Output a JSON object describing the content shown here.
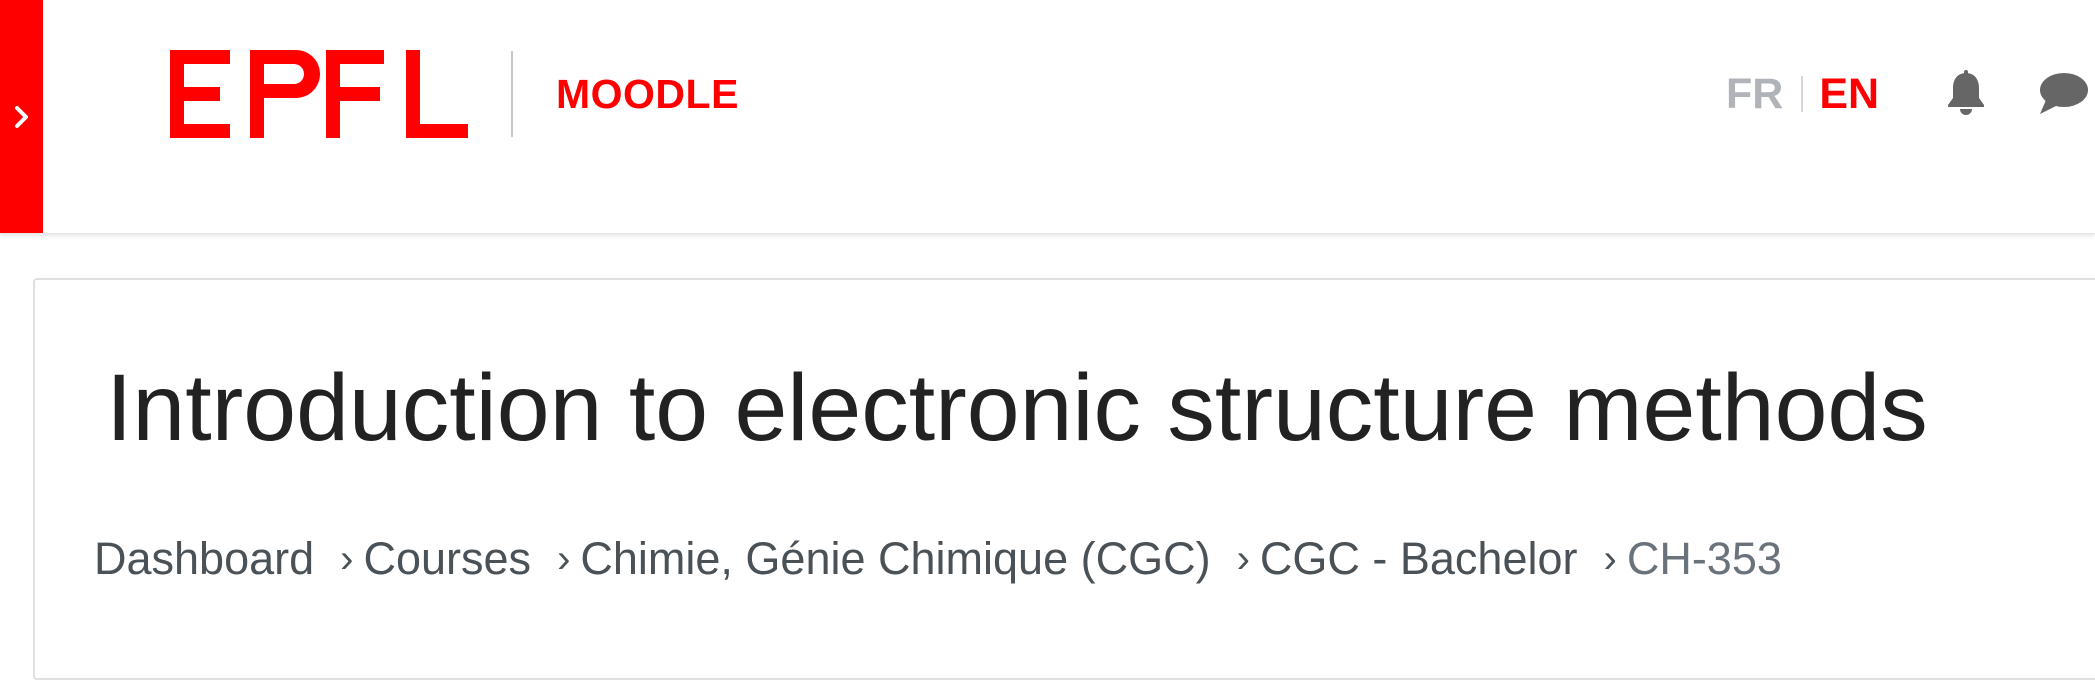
{
  "navbar": {
    "logo_text": "EPFL",
    "site_name": "MOODLE",
    "languages": {
      "fr": "FR",
      "en": "EN",
      "active": "EN"
    },
    "icons": [
      "chevron-right-icon",
      "bell-icon",
      "chat-icon"
    ],
    "accent_color": "#ff0000"
  },
  "page": {
    "title": "Introduction to electronic structure methods"
  },
  "breadcrumb": {
    "separator": "›",
    "items": [
      {
        "label": "Dashboard"
      },
      {
        "label": "Courses"
      },
      {
        "label": "Chimie, Génie Chimique (CGC)"
      },
      {
        "label": "CGC - Bachelor"
      },
      {
        "label": "CH-353"
      }
    ]
  }
}
